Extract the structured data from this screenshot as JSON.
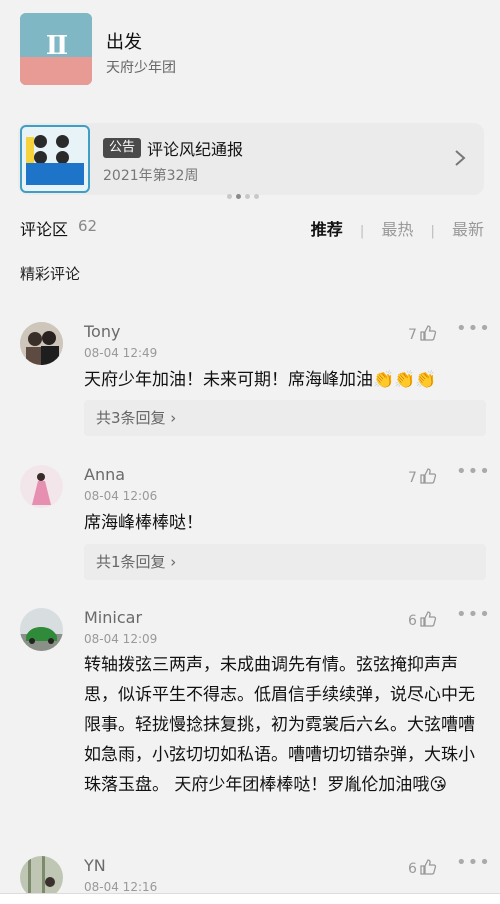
{
  "song": {
    "title": "出发",
    "artist": "天府少年团",
    "cover_mark": "II"
  },
  "notice": {
    "badge": "公告",
    "title": "评论风纪通报",
    "subtitle": "2021年第32周"
  },
  "comments_header": {
    "label": "评论区",
    "count": "62",
    "sort_options": [
      "推荐",
      "最热",
      "最新"
    ],
    "active_sort": "推荐"
  },
  "section_title": "精彩评论",
  "comments": [
    {
      "name": "Tony",
      "time": "08-04 12:49",
      "likes": "7",
      "text": "天府少年加油！未来可期！席海峰加油👏👏👏",
      "reply": "共3条回复 ›"
    },
    {
      "name": "Anna",
      "time": "08-04 12:06",
      "likes": "7",
      "text": "席海峰棒棒哒！",
      "reply": "共1条回复 ›"
    },
    {
      "name": "Minicar",
      "time": "08-04 12:09",
      "likes": "6",
      "text": "转轴拨弦三两声，未成曲调先有情。弦弦掩抑声声思，似诉平生不得志。低眉信手续续弹，说尽心中无限事。轻拢慢捻抹复挑，初为霓裳后六幺。大弦嘈嘈如急雨，小弦切切如私语。嘈嘈切切错杂弹，大珠小珠落玉盘。 天府少年团棒棒哒！罗胤伦加油哦😘"
    },
    {
      "name": "YN",
      "time": "08-04 12:16",
      "likes": "6"
    }
  ],
  "more_glyph": "•••"
}
